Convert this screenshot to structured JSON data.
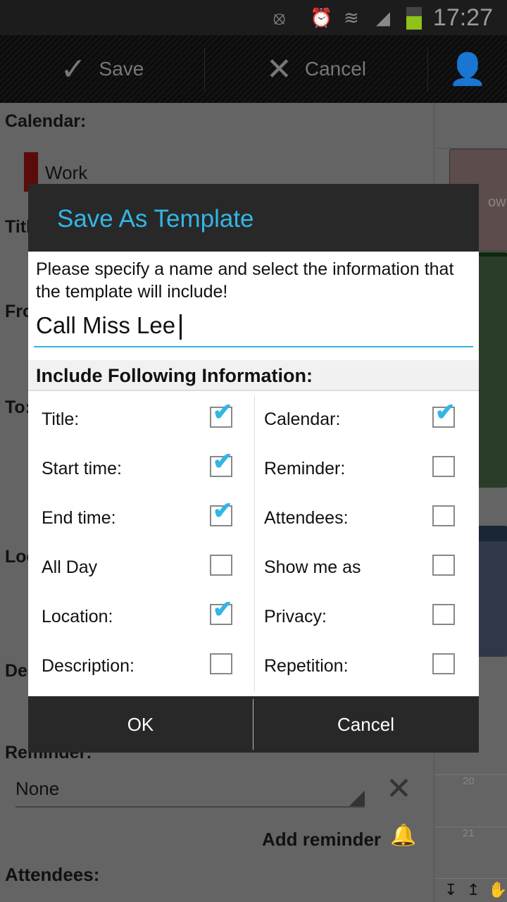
{
  "status_bar": {
    "time": "17:27",
    "battery_level": 0.6,
    "icons": [
      "mute-vibrate-icon",
      "alarm-icon",
      "wifi-icon",
      "signal-icon",
      "battery-icon"
    ]
  },
  "action_bar": {
    "save_label": "Save",
    "cancel_label": "Cancel",
    "icons": [
      "check-icon",
      "close-icon",
      "person-forward-icon"
    ]
  },
  "form": {
    "calendar_label": "Calendar:",
    "calendar_value": "Work",
    "calendar_color": "#5a0c0c",
    "title_label": "Title:",
    "from_label": "From:",
    "to_label": "To:",
    "location_label": "Location:",
    "description_label": "Description:",
    "reminder_label": "Reminder:",
    "reminder_value": "None",
    "add_reminder": "Add reminder",
    "attendees_label": "Attendees:"
  },
  "side_calendar": {
    "event_text": "ow!",
    "hours": [
      "20",
      "21"
    ]
  },
  "dialog": {
    "title": "Save As Template",
    "message": "Please specify a name and select the information that the template will include!",
    "name_value": "Call Miss Lee",
    "section_title": "Include Following Information:",
    "left_options": [
      {
        "label": "Title:",
        "checked": true
      },
      {
        "label": "Start time:",
        "checked": true
      },
      {
        "label": "End time:",
        "checked": true
      },
      {
        "label": "All Day",
        "checked": false
      },
      {
        "label": "Location:",
        "checked": true
      },
      {
        "label": "Description:",
        "checked": false
      }
    ],
    "right_options": [
      {
        "label": "Calendar:",
        "checked": true
      },
      {
        "label": "Reminder:",
        "checked": false
      },
      {
        "label": "Attendees:",
        "checked": false
      },
      {
        "label": "Show me as",
        "checked": false
      },
      {
        "label": "Privacy:",
        "checked": false
      },
      {
        "label": "Repetition:",
        "checked": false
      }
    ],
    "ok_label": "OK",
    "cancel_label": "Cancel"
  },
  "colors": {
    "accent": "#33b5e5",
    "dialog_header": "#282828"
  }
}
